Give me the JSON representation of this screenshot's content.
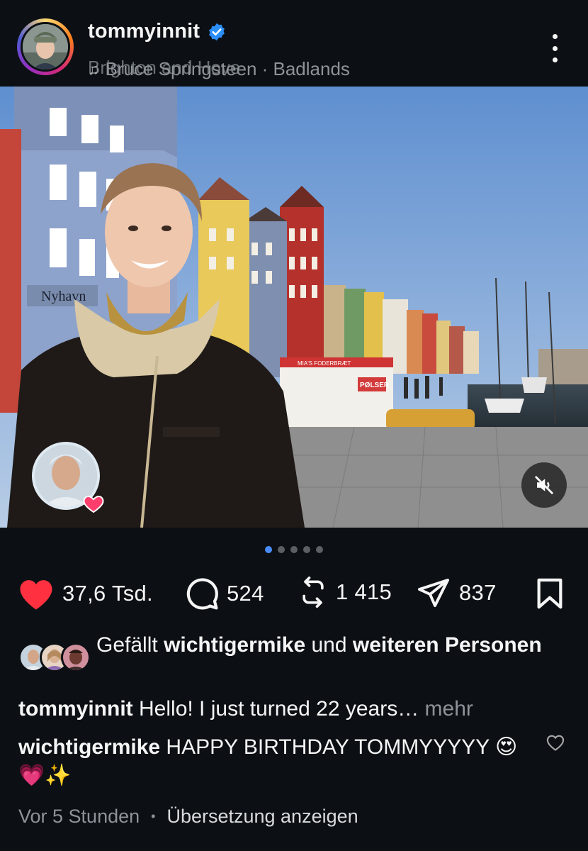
{
  "post": {
    "username": "tommyinnit",
    "location": "Brighton and Hove",
    "music": "Bruce Springsteen · Badlands",
    "icons": [
      "verified-badge-icon",
      "more-options-icon",
      "music-note-icon",
      "mute-icon",
      "heart-icon",
      "comment-icon",
      "repost-icon",
      "share-icon",
      "bookmark-icon"
    ]
  },
  "photo": {
    "sign_text": "Nyhavn",
    "kiosk_text": "MIA'S FODERBRÆT",
    "polser_text": "PØLSER",
    "carousel": {
      "total": 5,
      "active_index": 1
    },
    "liker_badge_icon": "heart-icon"
  },
  "actions": {
    "likes": "37,6 Tsd.",
    "comments": "524",
    "reposts": "1 415",
    "shares": "837"
  },
  "liked_by": {
    "prefix": "Gefällt",
    "user": "wichtigermike",
    "middle": "und",
    "suffix": "weiteren Personen"
  },
  "caption": {
    "user": "tommyinnit",
    "text": "Hello! I just turned 22 years…",
    "more": "mehr"
  },
  "comment": {
    "user": "wichtigermike",
    "text": "HAPPY BIRTHDAY TOMMYYYYY 😍💗✨"
  },
  "meta": {
    "time": "Vor 5 Stunden",
    "separator": "•",
    "translate": "Übersetzung anzeigen"
  },
  "colors": {
    "background": "#0c1014",
    "like_red": "#ff3040",
    "link_blue": "#4a8cf7",
    "muted_text": "#8e9399"
  }
}
